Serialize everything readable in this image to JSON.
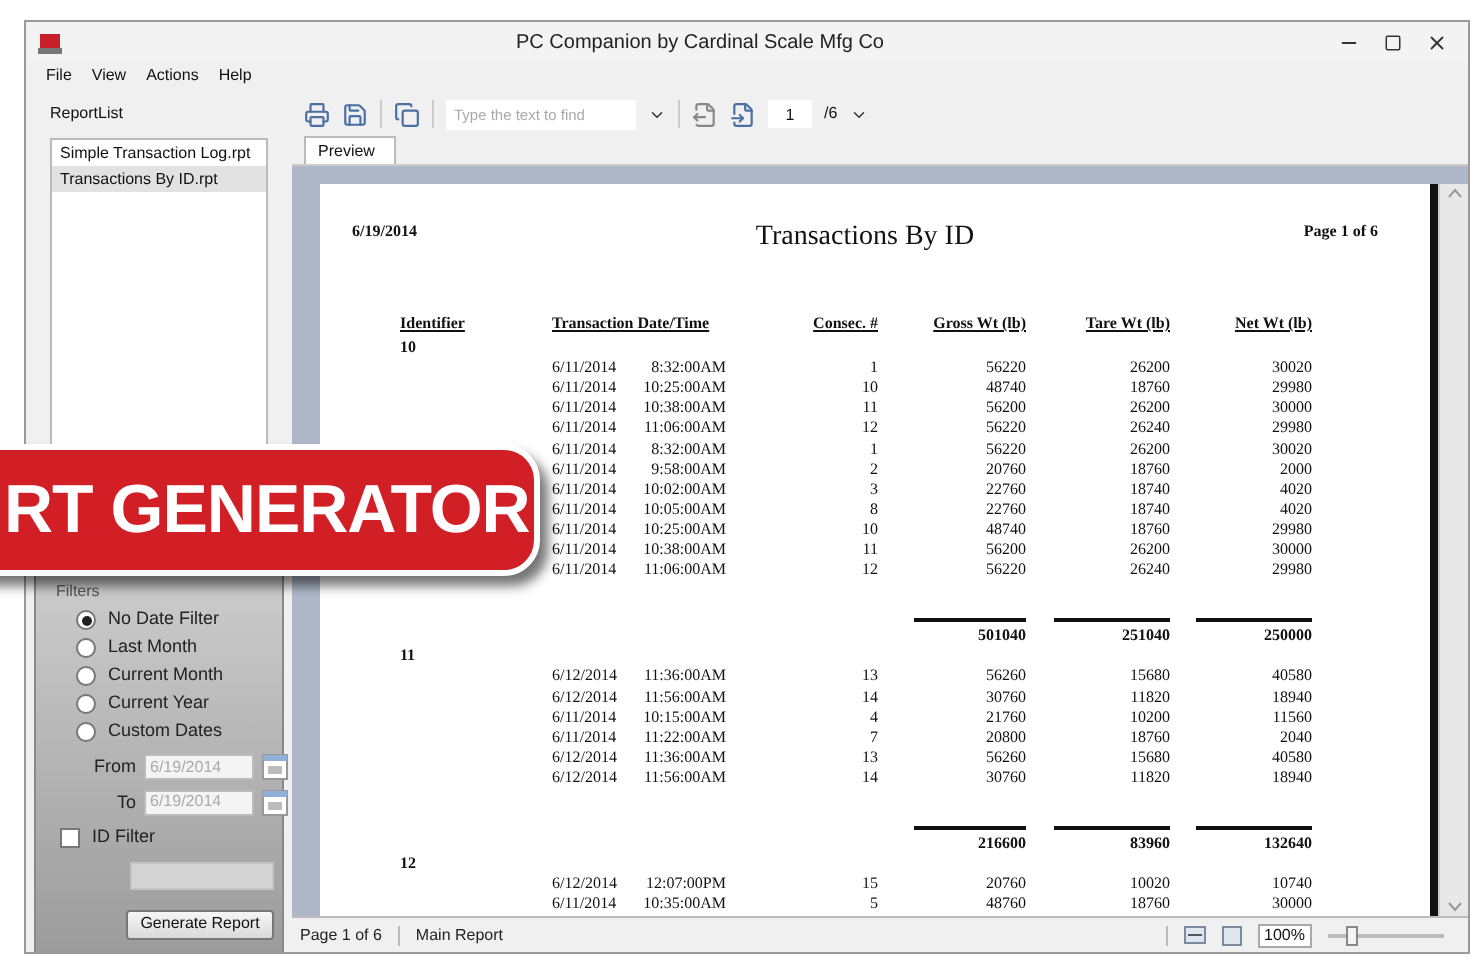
{
  "window": {
    "title": "PC Companion by Cardinal Scale Mfg Co"
  },
  "menu": [
    "File",
    "View",
    "Actions",
    "Help"
  ],
  "report_list": {
    "label": "ReportList",
    "items": [
      {
        "label": "Simple Transaction Log.rpt",
        "selected": false
      },
      {
        "label": "Transactions By ID.rpt",
        "selected": true
      }
    ]
  },
  "filters": {
    "label": "Filters",
    "options": [
      {
        "label": "No Date Filter",
        "selected": true
      },
      {
        "label": "Last Month",
        "selected": false
      },
      {
        "label": "Current Month",
        "selected": false
      },
      {
        "label": "Current Year",
        "selected": false
      },
      {
        "label": "Custom Dates",
        "selected": false
      }
    ],
    "dates": [
      {
        "label": "From",
        "value": "6/19/2014",
        "disabled": true
      },
      {
        "label": "To",
        "value": "6/19/2014",
        "disabled": true
      }
    ],
    "id_filter": {
      "label": "ID Filter",
      "checked": false
    },
    "generate_button": "Generate Report"
  },
  "toolbar": {
    "search_placeholder": "Type the text to find",
    "page": "1",
    "page_total": "/6"
  },
  "tabs": [
    {
      "label": "Preview",
      "selected": true
    }
  ],
  "report": {
    "date": "6/19/2014",
    "title": "Transactions By ID",
    "page": "Page 1 of 6",
    "columns": [
      "Identifier",
      "Transaction Date/Time",
      "Consec. #",
      "Gross Wt (lb)",
      "Tare Wt (lb)",
      "Net Wt (lb)"
    ],
    "groups": [
      {
        "id": "10",
        "rows": [
          [
            "6/11/2014",
            "8:32:00AM",
            "1",
            "56220",
            "26200",
            "30020"
          ],
          [
            "6/11/2014",
            "10:25:00AM",
            "10",
            "48740",
            "18760",
            "29980"
          ],
          [
            "6/11/2014",
            "10:38:00AM",
            "11",
            "56200",
            "26200",
            "30000"
          ],
          [
            "6/11/2014",
            "11:06:00AM",
            "12",
            "56220",
            "26240",
            "29980"
          ],
          [
            "6/11/2014",
            "8:32:00AM",
            "1",
            "56220",
            "26200",
            "30020"
          ],
          [
            "6/11/2014",
            "9:58:00AM",
            "2",
            "20760",
            "18760",
            "2000"
          ],
          [
            "6/11/2014",
            "10:02:00AM",
            "3",
            "22760",
            "18740",
            "4020"
          ],
          [
            "6/11/2014",
            "10:05:00AM",
            "8",
            "22760",
            "18740",
            "4020"
          ],
          [
            "6/11/2014",
            "10:25:00AM",
            "10",
            "48740",
            "18760",
            "29980"
          ],
          [
            "6/11/2014",
            "10:38:00AM",
            "11",
            "56200",
            "26200",
            "30000"
          ],
          [
            "6/11/2014",
            "11:06:00AM",
            "12",
            "56220",
            "26240",
            "29980"
          ]
        ],
        "totals": [
          "501040",
          "251040",
          "250000"
        ]
      },
      {
        "id": "11",
        "rows": [
          [
            "6/12/2014",
            "11:36:00AM",
            "13",
            "56260",
            "15680",
            "40580"
          ],
          [
            "6/12/2014",
            "11:56:00AM",
            "14",
            "30760",
            "11820",
            "18940"
          ],
          [
            "6/11/2014",
            "10:15:00AM",
            "4",
            "21760",
            "10200",
            "11560"
          ],
          [
            "6/11/2014",
            "11:22:00AM",
            "7",
            "20800",
            "18760",
            "2040"
          ],
          [
            "6/12/2014",
            "11:36:00AM",
            "13",
            "56260",
            "15680",
            "40580"
          ],
          [
            "6/12/2014",
            "11:56:00AM",
            "14",
            "30760",
            "11820",
            "18940"
          ]
        ],
        "totals": [
          "216600",
          "83960",
          "132640"
        ]
      },
      {
        "id": "12",
        "rows": [
          [
            "6/12/2014",
            "12:07:00PM",
            "15",
            "20760",
            "10020",
            "10740"
          ],
          [
            "6/11/2014",
            "10:35:00AM",
            "5",
            "48760",
            "18760",
            "30000"
          ]
        ]
      }
    ]
  },
  "status_bar": {
    "page": "Page 1 of 6",
    "section": "Main Report",
    "zoom": "100%",
    "zoom_slider": {
      "level": 0.2
    }
  },
  "banner": {
    "text": "RT GENERATOR"
  }
}
